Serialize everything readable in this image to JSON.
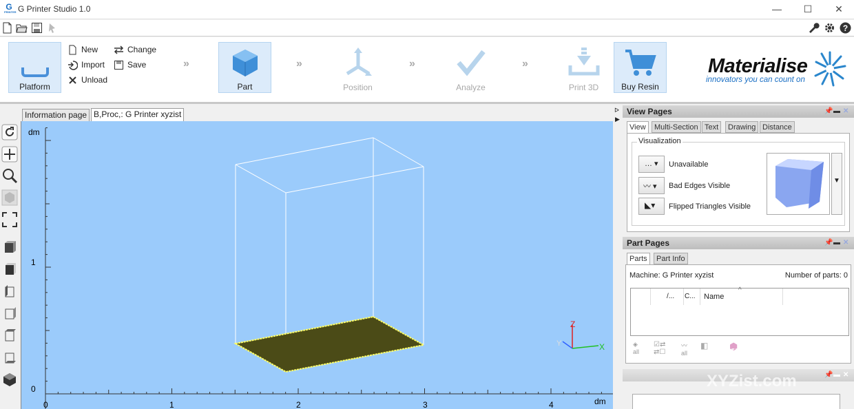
{
  "app": {
    "title": "G Printer Studio 1.0",
    "logo_letter": "G",
    "logo_sub": "PRINTER"
  },
  "window": {
    "minimize": "—",
    "maximize": "☐",
    "close": "✕"
  },
  "ribbon": {
    "platform": "Platform",
    "new": "New",
    "import": "Import",
    "unload": "Unload",
    "change": "Change",
    "save": "Save",
    "part": "Part",
    "position": "Position",
    "analyze": "Analyze",
    "print3d": "Print 3D",
    "buy_resin": "Buy Resin",
    "chevron": "»"
  },
  "brand": {
    "name": "Materialise",
    "tagline": "innovators you can count on"
  },
  "doc_tabs": [
    "Information page",
    "B,Proc,: G Printer xyzist"
  ],
  "viewport": {
    "vertical_unit": "dm",
    "horizontal_unit": "dm",
    "y_ticks": [
      "1",
      "0"
    ],
    "x_ticks": [
      "0",
      "1",
      "2",
      "3",
      "4"
    ],
    "axes": {
      "x": "X",
      "y": "Y",
      "z": "Z"
    }
  },
  "view_pages": {
    "title": "View Pages",
    "tabs": [
      "View",
      "Multi-Section",
      "Text",
      "Drawing",
      "Distance"
    ],
    "group": "Visualization",
    "rows": [
      "Unavailable",
      "Bad Edges Visible",
      "Flipped Triangles Visible"
    ]
  },
  "part_pages": {
    "title": "Part Pages",
    "tabs": [
      "Parts",
      "Part Info"
    ],
    "machine": "Machine: G Printer xyzist",
    "count": "Number of parts: 0",
    "columns": [
      "/...",
      "C...",
      "Name"
    ],
    "all": "all"
  },
  "watermark": {
    "line1": "XYZist",
    "line2": "XYZist.com"
  },
  "colors": {
    "accent": "#1a6fc4",
    "viewport": "#9bcbfb",
    "platform_plate": "#4b4b17",
    "platform_edge": "#ffff66"
  }
}
